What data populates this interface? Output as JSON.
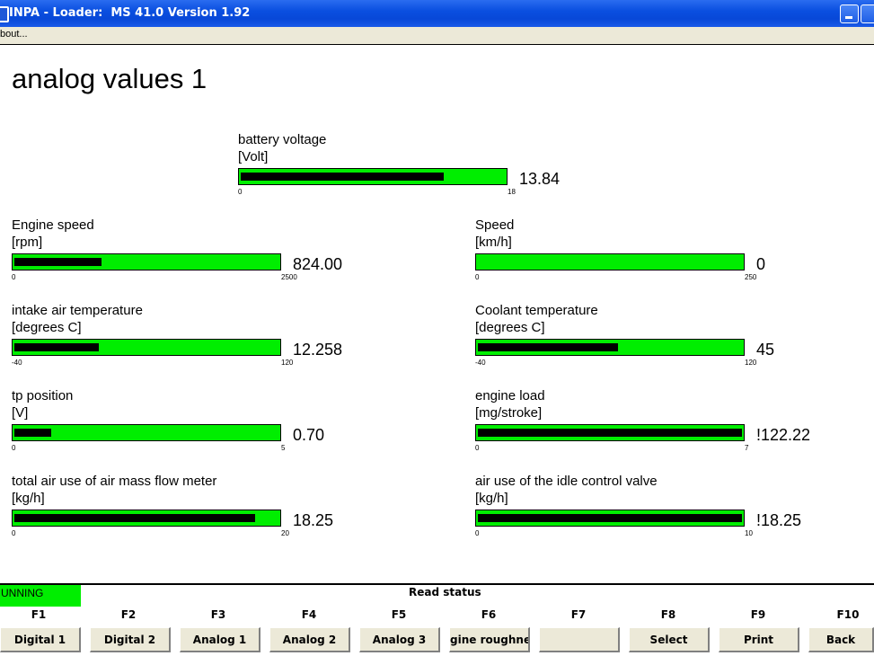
{
  "window": {
    "title": "INPA - Loader:  MS 41.0 Version 1.92"
  },
  "menu": {
    "items": [
      "bout..."
    ]
  },
  "page": {
    "title": "analog values 1"
  },
  "gauges": [
    {
      "label": "battery voltage",
      "unit": "[Volt]",
      "value": "13.84",
      "min": "0",
      "max": "18",
      "fill_fraction": 0.77
    },
    {
      "label": "Engine speed",
      "unit": "[rpm]",
      "value": "824.00",
      "min": "0",
      "max": "2500",
      "fill_fraction": 0.33
    },
    {
      "label": "Speed",
      "unit": "[km/h]",
      "value": "0",
      "min": "0",
      "max": "250",
      "fill_fraction": 0.0
    },
    {
      "label": "intake air temperature",
      "unit": "[degrees C]",
      "value": "12.258",
      "min": "-40",
      "max": "120",
      "fill_fraction": 0.32
    },
    {
      "label": "Coolant temperature",
      "unit": "[degrees C]",
      "value": "45",
      "min": "-40",
      "max": "120",
      "fill_fraction": 0.53
    },
    {
      "label": "tp position",
      "unit": "[V]",
      "value": "0.70",
      "min": "0",
      "max": "5",
      "fill_fraction": 0.14
    },
    {
      "label": "engine load",
      "unit": "[mg/stroke]",
      "value": "!122.22",
      "min": "0",
      "max": "7",
      "fill_fraction": 1.0
    },
    {
      "label": "total air use of air mass flow meter",
      "unit": "[kg/h]",
      "value": "18.25",
      "min": "0",
      "max": "20",
      "fill_fraction": 0.91
    },
    {
      "label": "air use of the idle control valve",
      "unit": "[kg/h]",
      "value": "!18.25",
      "min": "0",
      "max": "10",
      "fill_fraction": 1.0
    }
  ],
  "status": {
    "badge": "UNNING",
    "text": "Read status"
  },
  "function_keys": [
    {
      "key": "F1",
      "label": "Digital 1"
    },
    {
      "key": "F2",
      "label": "Digital 2"
    },
    {
      "key": "F3",
      "label": "Analog 1"
    },
    {
      "key": "F4",
      "label": "Analog 2"
    },
    {
      "key": "F5",
      "label": "Analog 3"
    },
    {
      "key": "F6",
      "label": "gine roughne"
    },
    {
      "key": "F7",
      "label": ""
    },
    {
      "key": "F8",
      "label": "Select"
    },
    {
      "key": "F9",
      "label": "Print"
    },
    {
      "key": "F10",
      "label": "Back"
    }
  ],
  "colors": {
    "titlebar": "#0a4fe0",
    "gauge_bar": "#00ee00",
    "gauge_fill": "#000000",
    "status_badge": "#00ee00"
  }
}
